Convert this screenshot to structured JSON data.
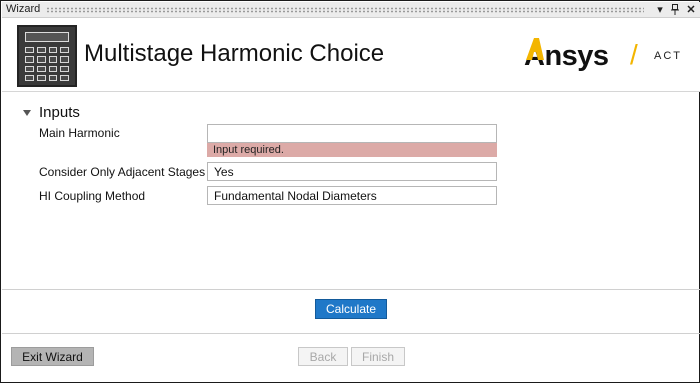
{
  "window": {
    "title": "Wizard",
    "pin_icon": "pin-icon",
    "close_icon": "close-icon",
    "dropdown_icon": "dropdown-arrow-icon"
  },
  "header": {
    "title": "Multistage Harmonic Choice",
    "brand_name": "Ansys",
    "brand_separator": "/",
    "brand_suffix": "ACT",
    "brand_accent": "#f3b500"
  },
  "inputs": {
    "section_label": "Inputs",
    "fields": [
      {
        "label": "Main Harmonic",
        "value": "",
        "error": "Input required."
      },
      {
        "label": "Consider Only Adjacent Stages",
        "value": "Yes"
      },
      {
        "label": "HI Coupling Method",
        "value": "Fundamental Nodal Diameters"
      }
    ]
  },
  "actions": {
    "calculate": "Calculate",
    "exit": "Exit Wizard",
    "back": "Back",
    "finish": "Finish"
  },
  "colors": {
    "primary_button": "#1f78c8",
    "error_background": "#dcaaa7"
  }
}
